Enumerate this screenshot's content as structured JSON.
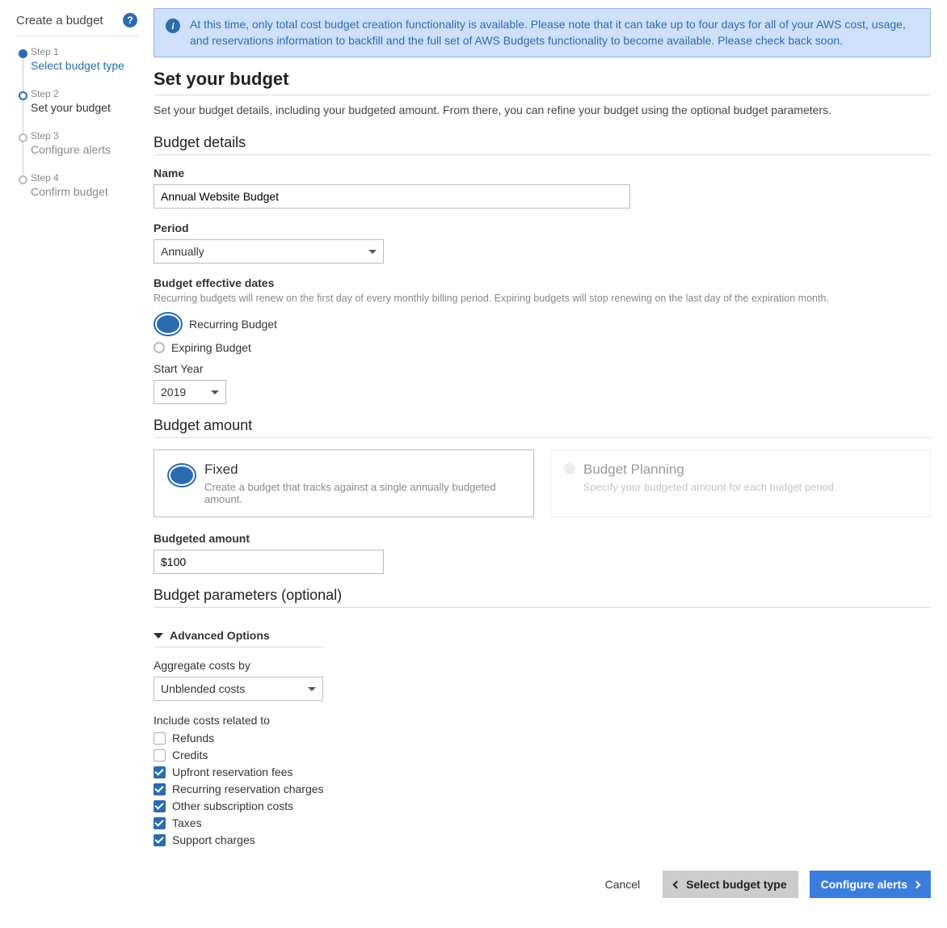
{
  "sidebar": {
    "title": "Create a budget",
    "steps": [
      {
        "label": "Step 1",
        "name": "Select budget type",
        "state": "done"
      },
      {
        "label": "Step 2",
        "name": "Set your budget",
        "state": "active"
      },
      {
        "label": "Step 3",
        "name": "Configure alerts",
        "state": ""
      },
      {
        "label": "Step 4",
        "name": "Confirm budget",
        "state": ""
      }
    ]
  },
  "alert": "At this time, only total cost budget creation functionality is available. Please note that it can take up to four days for all of your AWS cost, usage, and reservations information to backfill and the full set of AWS Budgets functionality to become available. Please check back soon.",
  "page": {
    "title": "Set your budget",
    "desc": "Set your budget details, including your budgeted amount. From there, you can refine your budget using the optional budget parameters."
  },
  "details": {
    "heading": "Budget details",
    "name_label": "Name",
    "name_value": "Annual Website Budget",
    "period_label": "Period",
    "period_value": "Annually",
    "eff_heading": "Budget effective dates",
    "eff_hint": "Recurring budgets will renew on the first day of every monthly billing period. Expiring budgets will stop renewing on the last day of the expiration month.",
    "recurring_label": "Recurring Budget",
    "expiring_label": "Expiring Budget",
    "start_year_label": "Start Year",
    "start_year_value": "2019"
  },
  "amount": {
    "heading": "Budget amount",
    "fixed_title": "Fixed",
    "fixed_desc": "Create a budget that tracks against a single annually budgeted amount.",
    "plan_title": "Budget Planning",
    "plan_desc": "Specify your budgeted amount for each budget period.",
    "budgeted_label": "Budgeted amount",
    "budgeted_value": "$100"
  },
  "params": {
    "heading": "Budget parameters (optional)",
    "adv_title": "Advanced Options",
    "agg_label": "Aggregate costs by",
    "agg_value": "Unblended costs",
    "include_label": "Include costs related to",
    "checks": [
      {
        "label": "Refunds",
        "on": false
      },
      {
        "label": "Credits",
        "on": false
      },
      {
        "label": "Upfront reservation fees",
        "on": true
      },
      {
        "label": "Recurring reservation charges",
        "on": true
      },
      {
        "label": "Other subscription costs",
        "on": true
      },
      {
        "label": "Taxes",
        "on": true
      },
      {
        "label": "Support charges",
        "on": true
      }
    ]
  },
  "footer": {
    "cancel": "Cancel",
    "back": "Select budget type",
    "next": "Configure alerts"
  }
}
